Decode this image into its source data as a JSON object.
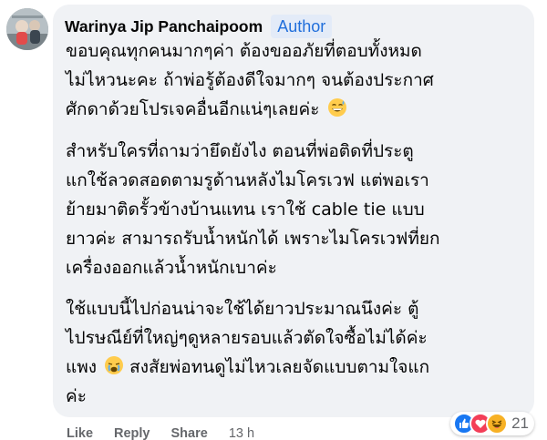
{
  "comment": {
    "author": "Warinya Jip Panchaipoom",
    "badge": "Author",
    "paragraphs": [
      [
        "ขอบคุณทุกคนมากๆค่า ต้องขออภัยที่ตอบทั้งหมด",
        "ไม่ไหวนะคะ ถ้าพ่อรู้ต้องดีใจมากๆ จนต้องประกาศ",
        "ศักดาด้วยโปรเจคอื่นอีกแน่ๆเลยค่ะ"
      ],
      [
        "สำหรับใครที่ถามว่ายึดยังไง ตอนที่พ่อติดที่ประตู",
        "แกใช้ลวดสอดตามรูด้านหลังไมโครเวฟ แต่พอเรา",
        "ย้ายมาติดรั้วข้างบ้านแทน เราใช้ cable tie แบบ",
        "ยาวค่ะ สามารถรับน้ำหนักได้ เพราะไมโครเวฟที่ยก",
        "เครื่องออกแล้วน้ำหนักเบาค่ะ"
      ],
      [
        "ใช้แบบนี้ไปก่อนน่าจะใช้ได้ยาวประมาณนึงค่ะ ตู้",
        "ไปรษณีย์ที่ใหญ่ๆดูหลายรอบแล้วตัดใจซื้อไม่ได้ค่ะ",
        "แพง",
        "ค่ะ"
      ]
    ],
    "p3_line3_tail": "สงสัยพ่อทนดูไม่ไหวเลยจัดแบบตามใจแก",
    "emoji_names": [
      "grinning-sweat-emoji",
      "weary-emoji"
    ]
  },
  "actions": {
    "like": "Like",
    "reply": "Reply",
    "share": "Share",
    "time": "13 h"
  },
  "reactions": {
    "icons": [
      "like-reaction",
      "love-reaction",
      "haha-reaction"
    ],
    "count": "21",
    "colors": {
      "like": "#1877f2",
      "love": "#f33e58",
      "haha": "#f7b125"
    }
  },
  "colors": {
    "bubble": "#f0f2f5",
    "badge_text": "#216fdb",
    "badge_bg": "#e3ebf8",
    "muted": "#65676b"
  }
}
